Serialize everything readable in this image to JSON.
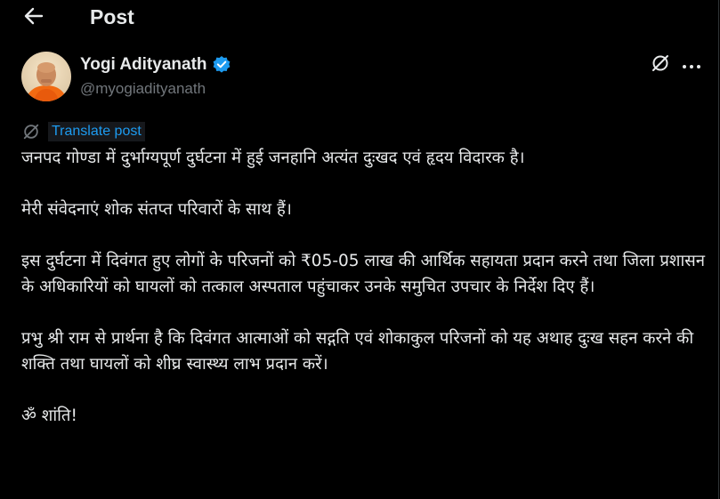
{
  "header": {
    "back_icon": "arrow-left-icon",
    "title": "Post"
  },
  "author": {
    "name": "Yogi Adityanath",
    "handle": "@myogiadityanath",
    "verified_icon": "verified-badge-icon",
    "verified_color": "#1d9bf0",
    "avatar_icon": "avatar-photo"
  },
  "actions": {
    "grok_icon": "grok-icon",
    "more_icon": "more-horizontal-icon"
  },
  "translate": {
    "icon": "grok-icon",
    "label": "Translate post"
  },
  "post": {
    "paragraphs": [
      "जनपद गोण्डा में दुर्भाग्यपूर्ण दुर्घटना में हुई जनहानि अत्यंत दुःखद एवं हृदय विदारक है।",
      "मेरी संवेदनाएं शोक संतप्त परिवारों के साथ हैं।",
      "इस दुर्घटना में दिवंगत हुए लोगों के परिजनों को ₹05-05 लाख की आर्थिक सहायता प्रदान करने तथा जिला प्रशासन के अधिकारियों को घायलों को तत्काल अस्पताल पहुंचाकर उनके समुचित उपचार के निर्देश दिए हैं।",
      "प्रभु श्री राम से प्रार्थना है कि दिवंगत आत्माओं को सद्गति एवं शोकाकुल परिजनों को यह अथाह दुःख सहन करने की शक्ति तथा घायलों को शीघ्र स्वास्थ्य लाभ प्रदान करें।",
      "ॐ शांति!"
    ]
  },
  "colors": {
    "background": "#000000",
    "text": "#e7e9ea",
    "secondary_text": "#71767b",
    "link": "#1d9bf0"
  }
}
